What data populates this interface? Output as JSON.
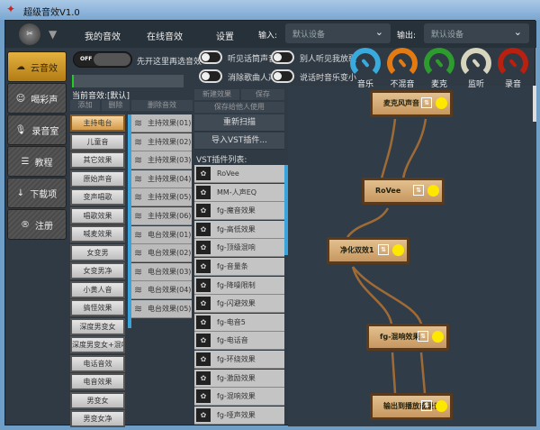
{
  "window": {
    "title": "超级音效V1.0"
  },
  "nav": {
    "tabs": [
      "我的音效",
      "在线音效",
      "设置"
    ],
    "input_label": "输入:",
    "input_value": "默认设备",
    "output_label": "输出:",
    "output_value": "默认设备"
  },
  "sidebar": [
    "云音效",
    "喝彩声",
    "录音室",
    "教程",
    "下载项",
    "注册"
  ],
  "main_toggle": {
    "state": "OFF",
    "label": "先开这里再选音效"
  },
  "options": [
    "听见话筒声音",
    "消除歌曲人声",
    "别人听见我放歌",
    "说话时音乐变小"
  ],
  "knobs": [
    {
      "label": "音乐",
      "color": "#3aa9dc"
    },
    {
      "label": "不混音",
      "color": "#e37b12"
    },
    {
      "label": "麦克",
      "color": "#2e9b2e"
    },
    {
      "label": "监听",
      "color": "#d8d5bf"
    },
    {
      "label": "录音",
      "color": "#b8200f"
    }
  ],
  "current": "当前音效:[默认]",
  "buttons": {
    "add": "添加",
    "delete": "删除",
    "delete_effect": "删除音效",
    "new_effect": "新建效果",
    "save": "保存",
    "save_share": "保存给他人使用",
    "rescan": "重新扫描",
    "import_vst": "导入VST插件...",
    "vst_list_label": "VST插件列表:"
  },
  "categories": [
    "主持电台",
    "儿童音",
    "其它效果",
    "原始声音",
    "变声唱歌",
    "唱歌效果",
    "喊麦效果",
    "女变男",
    "女变男净",
    "小黄人音",
    "搞怪效果",
    "深度男变女",
    "深度男变女+混响",
    "电话音效",
    "电音效果",
    "男变女",
    "男变女净"
  ],
  "effects": [
    "主持效果(01)",
    "主持效果(02)",
    "主持效果(03)",
    "主持效果(04)",
    "主持效果(05)",
    "主持效果(06)",
    "电台效果(01)",
    "电台效果(02)",
    "电台效果(03)",
    "电台效果(04)",
    "电台效果(05)"
  ],
  "vst_plugins": [
    "RoVee",
    "MM-人声EQ",
    "fg-魔音效果",
    "fg-高低效果",
    "fg-顶级混响",
    "fg-音量条",
    "fg-降噪限制",
    "fg-闪避效果",
    "fg-电音5",
    "fg-电话音",
    "fg-环绕效果",
    "fg-激励效果",
    "fg-混响效果",
    "fg-哑声效果"
  ],
  "nodes": [
    "麦克风声音",
    "RoVee",
    "净化双效1",
    "fg-混响效果",
    "输出到播放或录音"
  ]
}
